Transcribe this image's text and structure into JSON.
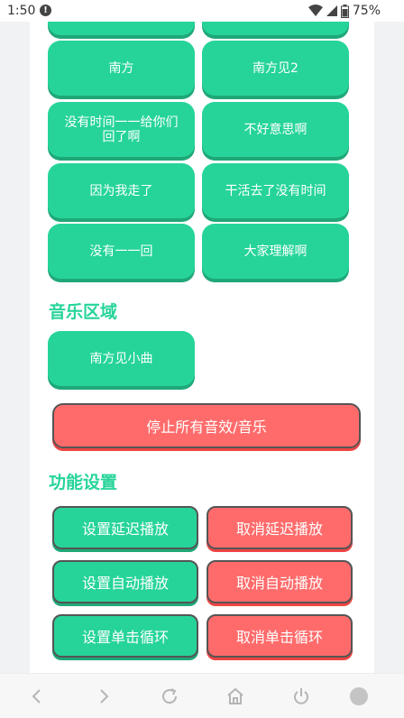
{
  "status_bar": {
    "time": "1:50",
    "alert_glyph": "!",
    "battery_pct": "75%",
    "icons": [
      "wifi-icon",
      "signal-icon",
      "battery-icon"
    ]
  },
  "sounds": {
    "tiles": [
      {
        "label": ""
      },
      {
        "label": ""
      },
      {
        "label": "南方"
      },
      {
        "label": "南方见2"
      },
      {
        "label": "没有时间一一给你们回了啊"
      },
      {
        "label": "不好意思啊"
      },
      {
        "label": "因为我走了"
      },
      {
        "label": "干活去了没有时间"
      },
      {
        "label": "没有一一回"
      },
      {
        "label": "大家理解啊"
      }
    ]
  },
  "music": {
    "title": "音乐区域",
    "tiles": [
      {
        "label": "南方见小曲"
      }
    ]
  },
  "stop_button": {
    "label": "停止所有音效/音乐"
  },
  "functions": {
    "title": "功能设置",
    "buttons": [
      {
        "label": "设置延迟播放",
        "color": "#26d49a"
      },
      {
        "label": "取消延迟播放",
        "color": "#ff6b6b"
      },
      {
        "label": "设置自动播放",
        "color": "#26d49a"
      },
      {
        "label": "取消自动播放",
        "color": "#ff6b6b"
      },
      {
        "label": "设置单击循环",
        "color": "#26d49a"
      },
      {
        "label": "取消单击循环",
        "color": "#ff6b6b"
      }
    ]
  },
  "colors": {
    "accent": "#26d49a",
    "danger": "#ff6b6b"
  },
  "nav_bar": {
    "icons": [
      "back-icon",
      "forward-icon",
      "refresh-icon",
      "home-icon",
      "power-icon",
      "circle-icon"
    ]
  }
}
